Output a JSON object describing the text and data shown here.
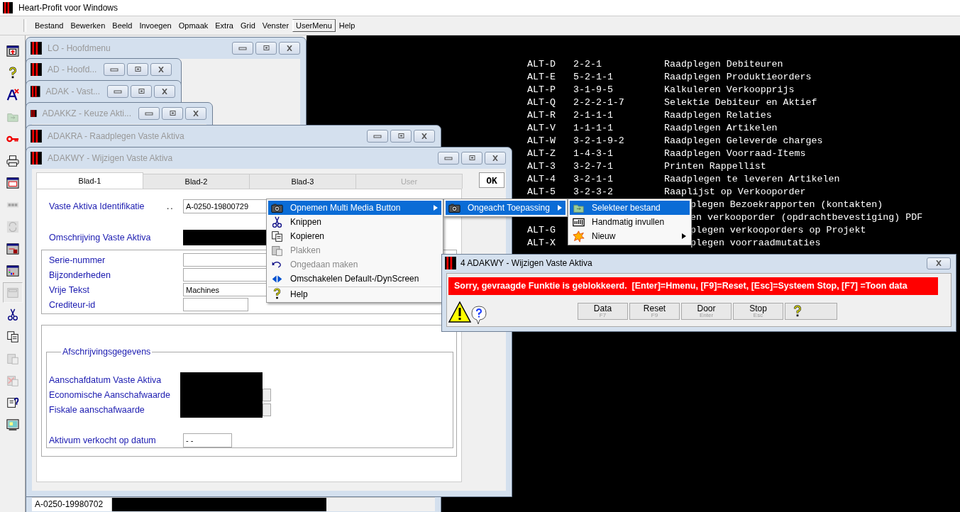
{
  "app_title": "Heart-Profit voor Windows",
  "menu_bar": [
    {
      "label": "Bestand",
      "selected": false
    },
    {
      "label": "Bewerken",
      "selected": false
    },
    {
      "label": "Beeld",
      "selected": false
    },
    {
      "label": "Invoegen",
      "selected": false
    },
    {
      "label": "Opmaak",
      "selected": false
    },
    {
      "label": "Extra",
      "selected": false
    },
    {
      "label": "Grid",
      "selected": false
    },
    {
      "label": "Venster",
      "selected": false
    },
    {
      "label": "UserMenu",
      "selected": true
    },
    {
      "label": "Help",
      "selected": false
    }
  ],
  "toolbar": [
    {
      "kind": "window-exit",
      "disabled": false,
      "pressed": false
    },
    {
      "kind": "help",
      "disabled": false,
      "pressed": false
    },
    {
      "kind": "font-delete",
      "disabled": false,
      "pressed": false
    },
    {
      "kind": "folder",
      "disabled": true,
      "pressed": false
    },
    {
      "kind": "key",
      "disabled": false,
      "pressed": false
    },
    {
      "kind": "printer",
      "disabled": false,
      "pressed": false
    },
    {
      "kind": "window-list",
      "disabled": false,
      "pressed": false
    },
    {
      "kind": "dots",
      "disabled": true,
      "pressed": false
    },
    {
      "kind": "refresh",
      "disabled": true,
      "pressed": false
    },
    {
      "kind": "window-lock",
      "disabled": false,
      "pressed": false
    },
    {
      "kind": "chart",
      "disabled": false,
      "pressed": false
    },
    {
      "kind": "window",
      "disabled": true,
      "pressed": true
    },
    {
      "kind": "scissors",
      "disabled": false,
      "pressed": false
    },
    {
      "kind": "copy",
      "disabled": false,
      "pressed": false
    },
    {
      "kind": "paste",
      "disabled": true,
      "pressed": false
    },
    {
      "kind": "paste-delete",
      "disabled": true,
      "pressed": false
    },
    {
      "kind": "clipboard-help",
      "disabled": false,
      "pressed": false
    },
    {
      "kind": "monitor",
      "disabled": false,
      "pressed": false
    }
  ],
  "console": {
    "rows": [
      {
        "kind": "full",
        "key": "ALT-D",
        "code": "2-2-1",
        "text": "Raadplegen Debiteuren"
      },
      {
        "kind": "full",
        "key": "ALT-E",
        "code": "5-2-1-1",
        "text": "Raadplegen Produktieorders"
      },
      {
        "kind": "full",
        "key": "ALT-P",
        "code": "3-1-9-5",
        "text": "Kalkuleren Verkoopprijs"
      },
      {
        "kind": "full",
        "key": "ALT-Q",
        "code": "2-2-2-1-7",
        "text": "Selektie Debiteur en Aktief"
      },
      {
        "kind": "full",
        "key": "ALT-R",
        "code": "2-1-1-1",
        "text": "Raadplegen Relaties"
      },
      {
        "kind": "full",
        "key": "ALT-V",
        "code": "1-1-1-1",
        "text": "Raadplegen Artikelen"
      },
      {
        "kind": "full",
        "key": "ALT-W",
        "code": "3-2-1-9-2",
        "text": "Raadplegen Geleverde charges"
      },
      {
        "kind": "full",
        "key": "ALT-Z",
        "code": "1-4-3-1",
        "text": "Raadplegen Voorraad-Items"
      },
      {
        "kind": "full",
        "key": "ALT-3",
        "code": "3-2-7-1",
        "text": "Printen Rappellist"
      },
      {
        "kind": "full",
        "key": "ALT-4",
        "code": "3-2-1-1",
        "text": "Raadplegen te leveren Artikelen"
      },
      {
        "kind": "full",
        "key": "ALT-5",
        "code": "3-2-3-2",
        "text": "Raaplijst op Verkooporder"
      },
      {
        "kind": "partial",
        "text": "plegen Bezoekrapporten (kontakten)"
      },
      {
        "kind": "partial",
        "text": "en verkooporder (opdrachtbevestiging) PDF"
      },
      {
        "kind": "partial",
        "key": "ALT-G",
        "text": "plegen verkooporders op Projekt"
      },
      {
        "kind": "partial",
        "key": "ALT-X",
        "text": "plegen voorraadmutaties"
      }
    ]
  },
  "back_windows": [
    {
      "title": "LO - Hoofdmenu",
      "active": false
    },
    {
      "title": "AD - Hoofd...",
      "active": false
    },
    {
      "title": "ADAK - Vast...",
      "active": false
    },
    {
      "title": "ADAKKZ - Keuze Akti...",
      "active": false
    },
    {
      "title": "ADAKRA - Raadplegen Vaste Aktiva",
      "active": false,
      "grid_row": "A-0250-19980702"
    }
  ],
  "form_window": {
    "title": "ADAKWY - Wijzigen Vaste Aktiva",
    "active": false,
    "tabs": [
      {
        "label": "Blad-1",
        "selected": true,
        "disabled": false
      },
      {
        "label": "Blad-2",
        "selected": false,
        "disabled": false
      },
      {
        "label": "Blad-3",
        "selected": false,
        "disabled": false
      },
      {
        "label": "User",
        "selected": false,
        "disabled": true
      }
    ],
    "ok_button": "OK",
    "identification": {
      "label": "Vaste Aktiva Identifikatie",
      "leader": "..",
      "value": "A-0250-19800729"
    },
    "description": {
      "label": "Omschrijving Vaste Aktiva"
    },
    "details": [
      {
        "label": "Serie-nummer"
      },
      {
        "label": "Bijzonderheden"
      },
      {
        "label": "Vrije Tekst",
        "value": "Machines"
      },
      {
        "label": "Crediteur-id"
      }
    ],
    "depreciation": {
      "legend": "Afschrijvingsgegevens",
      "rows": [
        {
          "label": "Aanschafdatum Vaste Aktiva",
          "spinner": false
        },
        {
          "label": "Economische Aanschafwaarde",
          "spinner": true
        },
        {
          "label": "Fiskale aanschafwaarde",
          "spinner": true
        }
      ],
      "sold_date": {
        "label": "Aktivum verkocht op datum",
        "value": "- -"
      }
    }
  },
  "context_menu": {
    "items": [
      {
        "kind": "camera",
        "label": "Opnemen Multi Media Button",
        "selected": true,
        "disabled": false,
        "submenu": true,
        "separator_before": false
      },
      {
        "kind": "scissors",
        "label": "Knippen",
        "selected": false,
        "disabled": false,
        "submenu": false,
        "separator_before": false
      },
      {
        "kind": "copy",
        "label": "Kopieren",
        "selected": false,
        "disabled": false,
        "submenu": false,
        "separator_before": false
      },
      {
        "kind": "paste",
        "label": "Plakken",
        "selected": false,
        "disabled": true,
        "submenu": false,
        "separator_before": false
      },
      {
        "kind": "undo",
        "label": "Ongedaan maken",
        "selected": false,
        "disabled": true,
        "submenu": false,
        "separator_before": false
      },
      {
        "kind": "arrows",
        "label": "Omschakelen Default-/DynScreen",
        "selected": false,
        "disabled": false,
        "submenu": false,
        "separator_before": false
      },
      {
        "kind": "help",
        "label": "Help",
        "selected": false,
        "disabled": false,
        "submenu": false,
        "separator_before": true
      }
    ],
    "submenu": [
      {
        "kind": "camera",
        "label": "Ongeacht Toepassing",
        "selected": true,
        "disabled": false,
        "submenu": true,
        "separator_before": false
      }
    ],
    "submenu_2": [
      {
        "kind": "folder",
        "label": "Selekteer bestand",
        "selected": true,
        "disabled": false,
        "submenu": false,
        "separator_before": false
      },
      {
        "kind": "textfield",
        "label": "Handmatig invullen",
        "selected": false,
        "disabled": false,
        "submenu": false,
        "separator_before": false
      },
      {
        "kind": "new",
        "label": "Nieuw",
        "selected": false,
        "disabled": false,
        "submenu": true,
        "separator_before": false
      }
    ]
  },
  "dialog": {
    "title": "4 ADAKWY - Wijzigen Vaste Aktiva",
    "active": true,
    "message": "Sorry, gevraagde Funktie is geblokkeerd.  [Enter]=Hmenu, [F9]=Reset, [Esc]=Systeem Stop, [F7] =Toon data",
    "buttons": [
      {
        "kind": "text",
        "label": "Data",
        "key": "F7"
      },
      {
        "kind": "text",
        "label": "Reset",
        "key": "F9"
      },
      {
        "kind": "text",
        "label": "Door",
        "key": "Enter"
      },
      {
        "kind": "text",
        "label": "Stop",
        "key": "Esc"
      },
      {
        "kind": "help"
      }
    ]
  }
}
